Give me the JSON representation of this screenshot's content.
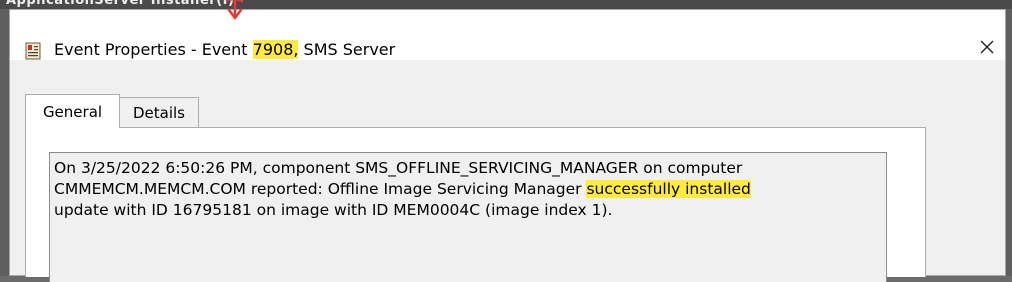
{
  "background": {
    "partial_text": "ApplicationServer Installer(I)"
  },
  "dialog": {
    "title_prefix": "Event Properties - Event ",
    "event_id": "7908,",
    "title_suffix": " SMS Server",
    "close_glyph": "✕"
  },
  "tabs": [
    {
      "label": "General",
      "selected": true
    },
    {
      "label": "Details",
      "selected": false
    }
  ],
  "message": {
    "line1": "On 3/25/2022 6:50:26 PM, component SMS_OFFLINE_SERVICING_MANAGER on computer",
    "line2_prefix": "CMMEMCM.MEMCM.COM reported:  Offline Image Servicing Manager ",
    "line2_highlight": "successfully installed",
    "line3": "update with ID 16795181 on image with ID MEM0004C (image index 1)."
  },
  "colors": {
    "highlight": "#ffeb3b",
    "annotation_arrow": "#e53935"
  },
  "icons": {
    "app": "event-log-icon",
    "close": "close-icon",
    "annotation": "red-arrow-icon"
  }
}
